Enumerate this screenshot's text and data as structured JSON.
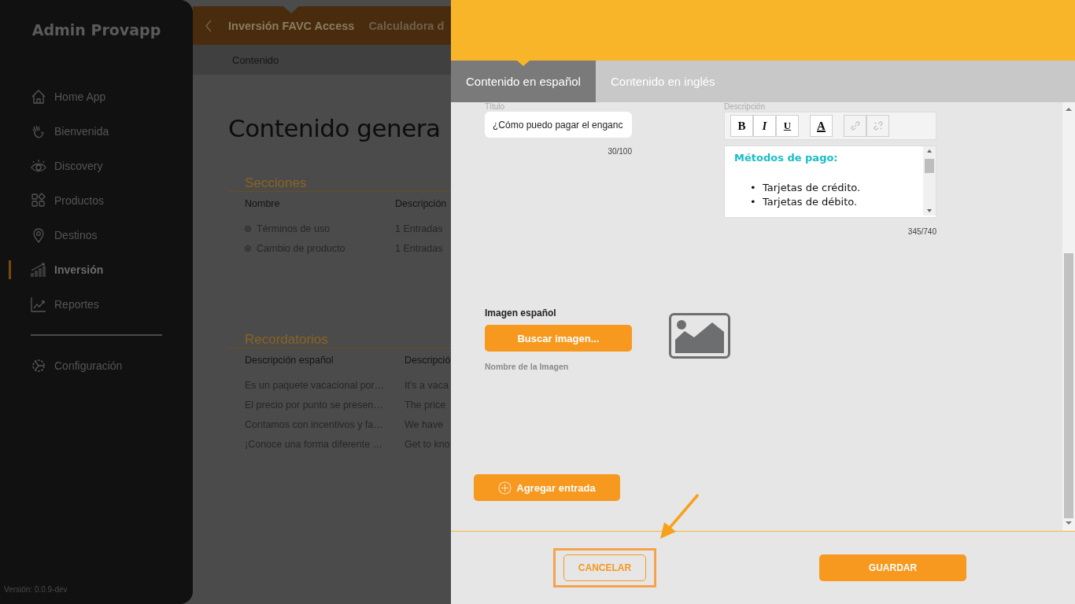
{
  "sidebar": {
    "title": "Admin Provapp",
    "items": [
      {
        "label": "Home App",
        "kind": "home",
        "selected": false
      },
      {
        "label": "Bienvenida",
        "kind": "hand",
        "selected": false
      },
      {
        "label": "Discovery",
        "kind": "eye",
        "selected": false
      },
      {
        "label": "Productos",
        "kind": "grid",
        "selected": false
      },
      {
        "label": "Destinos",
        "kind": "pin",
        "selected": false
      },
      {
        "label": "Inversión",
        "kind": "bars",
        "selected": true
      },
      {
        "label": "Reportes",
        "kind": "trend",
        "selected": false
      }
    ],
    "footer_items": [
      {
        "label": "Configuración",
        "kind": "gear",
        "selected": false
      }
    ],
    "version": "Versión: 0.0.9-dev"
  },
  "background_page": {
    "tabs": [
      {
        "label": "Inversión FAVC Access",
        "selected": true
      },
      {
        "label": "Calculadora d",
        "selected": false
      }
    ],
    "breadcrumb": "Contenido",
    "heading": "Contenido genera",
    "sections": {
      "title": "Secciones",
      "columns": [
        "Nombre",
        "Descripción"
      ],
      "rows": [
        {
          "name": "Términos de uso",
          "description": "1 Entradas",
          "selected": false
        },
        {
          "name": "Cambio de producto",
          "description": "1 Entradas",
          "selected": false
        }
      ]
    },
    "reminders": {
      "title": "Recordatorios",
      "columns": [
        "Descripción español",
        "Descripció"
      ],
      "rows": [
        [
          "Es un paquete vacacional por…",
          "It's a vaca"
        ],
        [
          "El precio por punto se presen…",
          "The price"
        ],
        [
          "Contamos con incentivos y fa…",
          "We have"
        ],
        [
          "¡Conoce una forma diferente …",
          "Get to kno"
        ]
      ]
    }
  },
  "drawer": {
    "tabs": [
      {
        "label": "Contenido en español",
        "selected": true
      },
      {
        "label": "Contenido en inglés",
        "selected": false
      }
    ],
    "title_field": {
      "label": "Título",
      "value": "¿Cómo puedo pagar el enganc",
      "counter": "30/100"
    },
    "description": {
      "label": "Descripción",
      "toolbar": [
        {
          "kind": "bold",
          "label": "B",
          "disabled": false
        },
        {
          "kind": "italic",
          "label": "I",
          "disabled": false
        },
        {
          "kind": "underline",
          "label": "U",
          "disabled": false
        },
        {
          "kind": "color",
          "label": "A",
          "disabled": false
        },
        {
          "kind": "link",
          "disabled": true
        },
        {
          "kind": "unlink",
          "disabled": true
        }
      ],
      "heading": "Métodos de pago:",
      "items": [
        {
          "marker": "•",
          "text": "Tarjetas de crédito."
        },
        {
          "marker": "•",
          "text": "Tarjetas de débito."
        }
      ],
      "counter": "345/740"
    },
    "image": {
      "label": "Imagen español",
      "button": "Buscar imagen...",
      "filename_placeholder": "Nombre de la Imagen"
    },
    "add_button": "Agregar entrada",
    "footer": {
      "cancel": {
        "label": "CANCELAR",
        "highlighted": true
      },
      "save": {
        "label": "GUARDAR"
      }
    }
  }
}
